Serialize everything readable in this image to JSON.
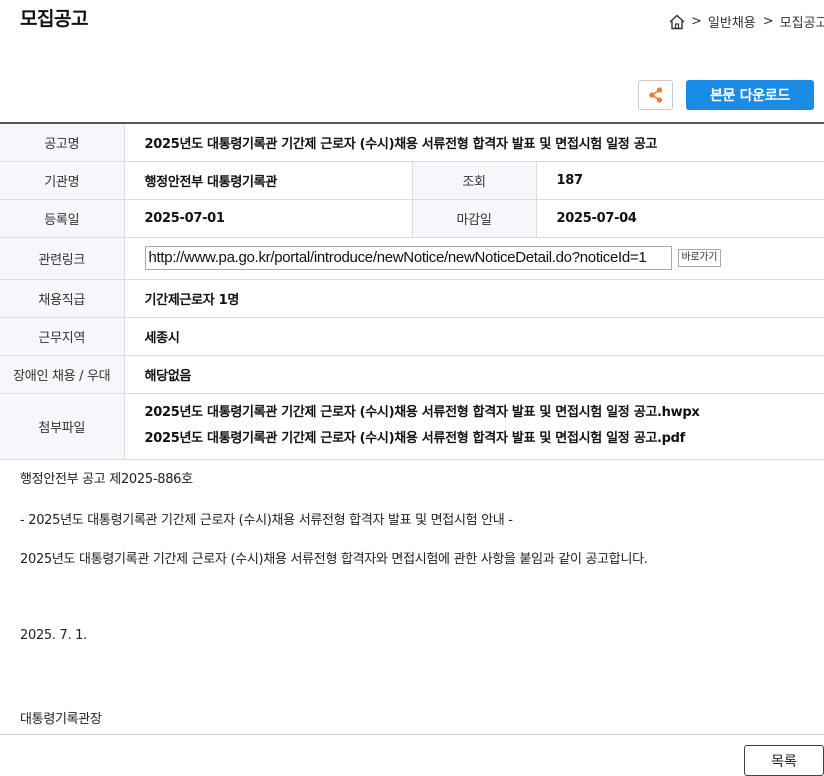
{
  "page_title": "모집공고",
  "breadcrumb": {
    "items": [
      "일반채용",
      "모집공고"
    ],
    "separator": ">"
  },
  "actions": {
    "download_label": "본문 다운로드",
    "share_color": "#f07c2e",
    "download_bg": "#1a8ce6"
  },
  "info": {
    "title_label": "공고명",
    "title_value": "2025년도 대통령기록관 기간제 근로자 (수시)채용 서류전형 합격자 발표 및 면접시험 일정 공고",
    "org_label": "기관명",
    "org_value": "행정안전부 대통령기록관",
    "views_label": "조회",
    "views_value": "187",
    "reg_label": "등록일",
    "reg_value": "2025-07-01",
    "deadline_label": "마감일",
    "deadline_value": "2025-07-04",
    "link_label": "관련링크",
    "link_value": "http://www.pa.go.kr/portal/introduce/newNotice/newNoticeDetail.do?noticeId=1",
    "link_button": "바로가기",
    "position_label": "채용직급",
    "position_value": "기간제근로자 1명",
    "region_label": "근무지역",
    "region_value": "세종시",
    "disability_label": "장애인 채용 / 우대",
    "disability_value": "해당없음",
    "files_label": "첨부파일",
    "files": [
      "2025년도 대통령기록관 기간제 근로자 (수시)채용 서류전형 합격자 발표 및 면접시험 일정 공고.hwpx",
      "2025년도 대통령기록관 기간제 근로자 (수시)채용 서류전형 합격자 발표 및 면접시험 일정 공고.pdf"
    ]
  },
  "body": {
    "line1": "행정안전부 공고 제2025-886호",
    "line2": "- 2025년도 대통령기록관 기간제 근로자 (수시)채용 서류전형 합격자 발표 및 면접시험 안내 -",
    "line3": "2025년도 대통령기록관 기간제 근로자 (수시)채용 서류전형 합격자와 면접시험에 관한 사항을 붙임과 같이 공고합니다.",
    "date": "2025. 7. 1.",
    "signature": "대통령기록관장"
  },
  "list_button": "목록"
}
